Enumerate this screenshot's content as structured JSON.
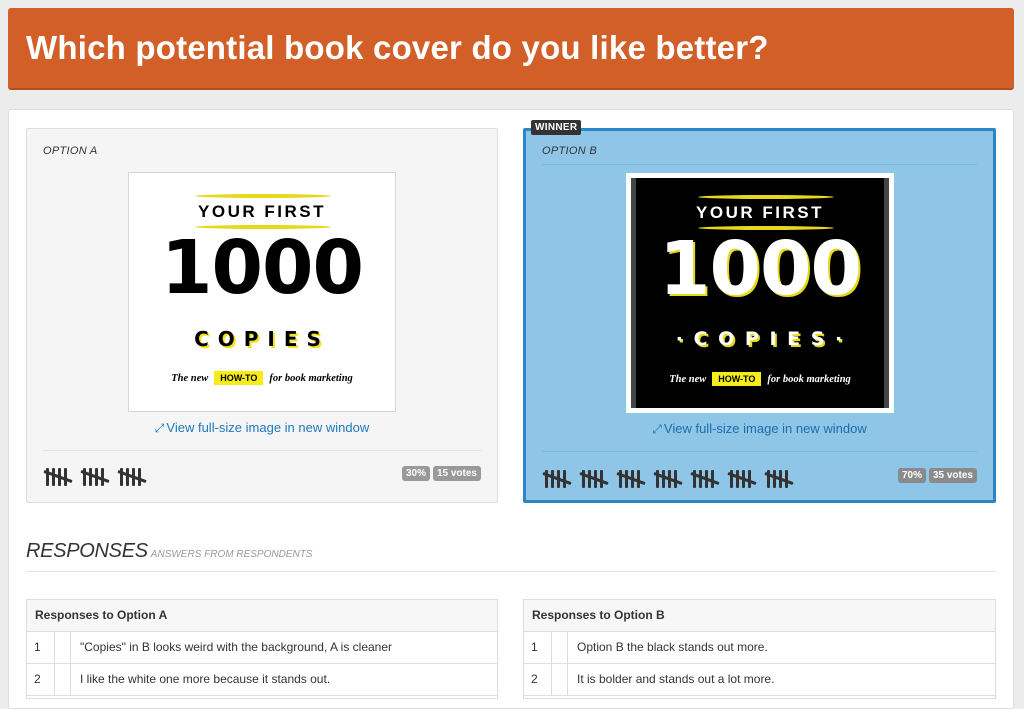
{
  "header": {
    "title": "Which potential book cover do you like better?"
  },
  "options": [
    {
      "label": "OPTION A",
      "cover": {
        "line1": "YOUR FIRST",
        "number": "1000",
        "line2": "COPIES",
        "tag_pre": "The new",
        "tag_highlight": "HOW-TO",
        "tag_post": "for book marketing"
      },
      "view_link": "View full-size image in new window",
      "percent": "30%",
      "votes": "15 votes",
      "tally_groups": 3
    },
    {
      "label": "OPTION B",
      "winner_badge": "WINNER",
      "cover": {
        "line1": "YOUR FIRST",
        "number": "1000",
        "line2": "· C O P I E S ·",
        "tag_pre": "The new",
        "tag_highlight": "HOW-TO",
        "tag_post": "for book marketing"
      },
      "view_link": "View full-size image in new window",
      "percent": "70%",
      "votes": "35 votes",
      "tally_groups": 7
    }
  ],
  "responses": {
    "title": "RESPONSES",
    "subtitle": "answers from respondents",
    "tables": [
      {
        "header": "Responses to Option A",
        "rows": [
          {
            "num": "1",
            "text": "\"Copies\" in B looks weird with the background, A is cleaner"
          },
          {
            "num": "2",
            "text": "I like the white one more because it stands out."
          }
        ]
      },
      {
        "header": "Responses to Option B",
        "rows": [
          {
            "num": "1",
            "text": "Option B the black stands out more."
          },
          {
            "num": "2",
            "text": "It is bolder and stands out a lot more."
          }
        ]
      }
    ]
  },
  "icons": {
    "expand": "expand-arrows-icon",
    "tally": "tally-marks-icon"
  },
  "colors": {
    "header_bg": "#d35f28",
    "winner_bg": "#8fc6e7",
    "winner_border": "#2a86c4",
    "link": "#1d78bf"
  }
}
